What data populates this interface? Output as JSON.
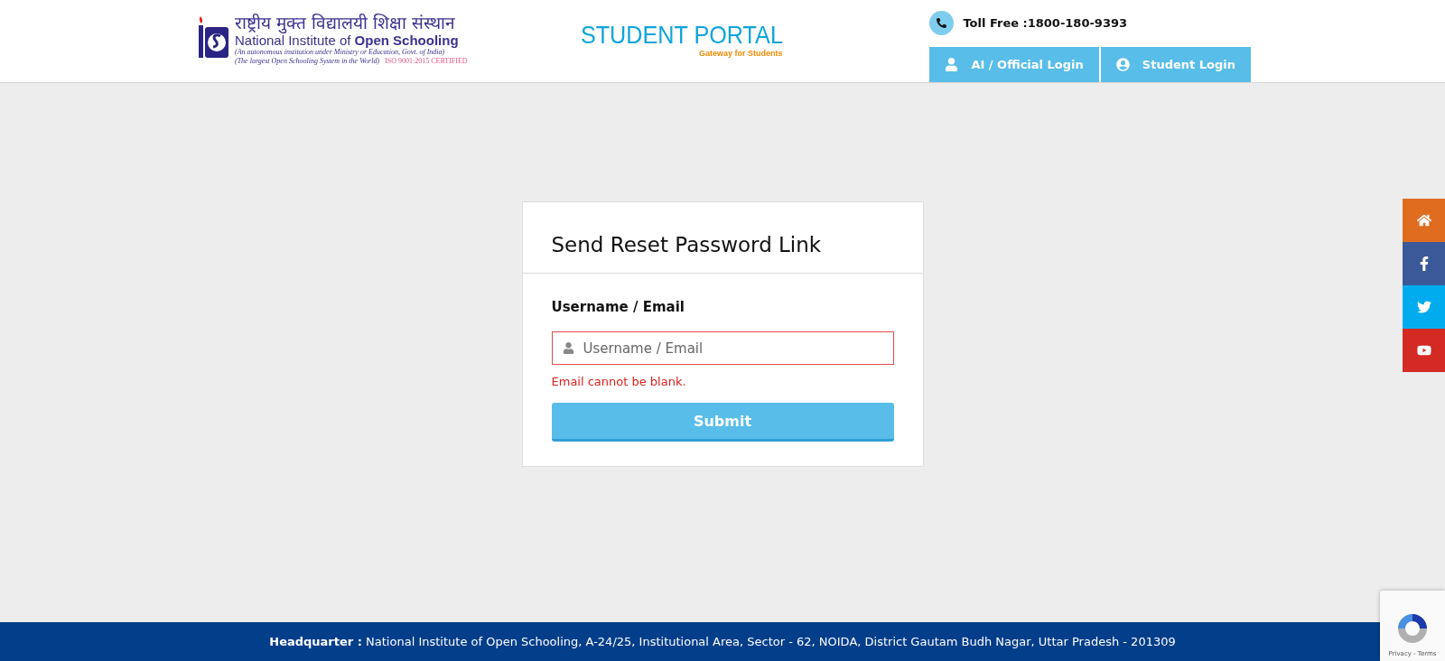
{
  "header": {
    "logo": {
      "hindi_name": "राष्ट्रीय मुक्त विद्यालयी शिक्षा संस्थान",
      "english_prefix": "National Institute of ",
      "english_bold": "Open Schooling",
      "tagline_1": "(An autonomous institution under Ministry or Education, Govt. of India)",
      "tagline_2": "(The largest Open Schooling System in the World)",
      "certification": "ISO 9001:2015 CERTIFIED"
    },
    "portal": {
      "title": "STUDENT PORTAL",
      "subtitle": "Gateway for Students"
    },
    "toll_free": "Toll Free :1800-180-9393",
    "login_buttons": [
      {
        "label": "AI / Official Login",
        "kind": "official"
      },
      {
        "label": "Student Login",
        "kind": "student"
      }
    ]
  },
  "form": {
    "title": "Send Reset Password Link",
    "field_label": "Username / Email",
    "field": {
      "placeholder": "Username / Email",
      "invalid": true
    },
    "error": "Email cannot be blank.",
    "submit": "Submit"
  },
  "social_bar": [
    {
      "kind": "home",
      "color": "#e06c1f"
    },
    {
      "kind": "facebook",
      "color": "#3b5998"
    },
    {
      "kind": "twitter",
      "color": "#00aced"
    },
    {
      "kind": "youtube",
      "color": "#d42a24"
    }
  ],
  "recaptcha": {
    "links": "Privacy - Terms"
  },
  "footer": {
    "address": "**Headquarter :** National Institute of Open Schooling, A-24/25, Institutional Area, Sector - 62, NOIDA, District Gautam Budh Nagar, Uttar Pradesh - 201309"
  }
}
